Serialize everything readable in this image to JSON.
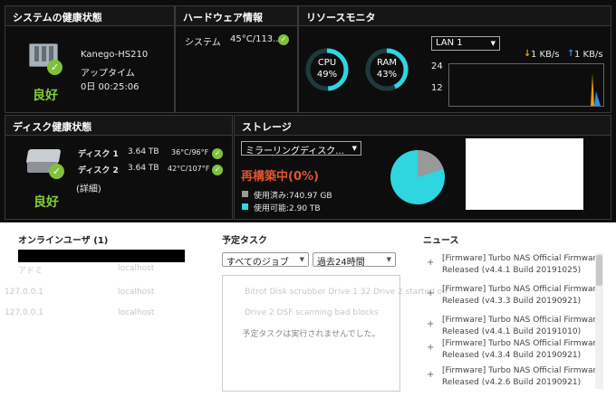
{
  "system_health": {
    "title": "システムの健康状態",
    "server_name": "Kanego-HS210",
    "uptime_label": "アップタイム",
    "uptime_value": "0日 00:25:06",
    "status": "良好"
  },
  "hardware_info": {
    "title": "ハードウェア情報",
    "system_label": "システム",
    "system_value": "45°C/113..."
  },
  "resource_monitor": {
    "title": "リソースモニタ",
    "cpu": {
      "label": "CPU",
      "value": "49%",
      "fraction": 0.49
    },
    "ram": {
      "label": "RAM",
      "value": "43%",
      "fraction": 0.43
    },
    "lan_select": "LAN 1",
    "download": "1 KB/s",
    "upload": "1 KB/s",
    "y_ticks": [
      "24",
      "12"
    ]
  },
  "disk_health": {
    "title": "ディスク健康状態",
    "disks": [
      {
        "label": "ディスク 1",
        "size": "3.64 TB",
        "temp": "36°C/96°F"
      },
      {
        "label": "ディスク 2",
        "size": "3.64 TB",
        "temp": "42°C/107°F"
      }
    ],
    "details_link": "(詳細)",
    "status": "良好"
  },
  "storage": {
    "title": "ストレージ",
    "volume_select": "ミラーリングディスク...",
    "rebuild_status": "再構築中(0%)",
    "used": "使用済み:740.97 GB",
    "available": "使用可能:2.90 TB",
    "used_fraction": 0.2
  },
  "online_users": {
    "title": "オンラインユーザ (1)",
    "ghost_rows": [
      [
        "アドミ",
        "localhost"
      ],
      [
        "127.0.0.1",
        "localhost"
      ],
      [
        "127.0.0.1",
        "localhost"
      ]
    ]
  },
  "scheduled_tasks": {
    "title": "予定タスク",
    "job_select": "すべてのジョブ",
    "period_select": "過去24時間",
    "empty_message": "予定タスクは実行されませんでした。",
    "ghost_lines": [
      "Bitrot Disk scrubber Drive 1 32 Drive 2 started on",
      "Drive 2 DSF scanning bad blocks"
    ]
  },
  "news": {
    "title": "ニュース",
    "items": [
      "[Firmware] Turbo NAS Official Firmware Released (v4.4.1 Build 20191025)",
      "[Firmware] Turbo NAS Official Firmware Released (v4.3.3 Build 20190921)",
      "[Firmware] Turbo NAS Official Firmware Released (v4.4.1 Build 20191010)",
      "[Firmware] Turbo NAS Official Firmware Released (v4.3.4 Build 20190921)",
      "[Firmware] Turbo NAS Official Firmware Released (v4.2.6 Build 20190921)"
    ]
  },
  "colors": {
    "accent_cyan": "#2ed6e0",
    "good_green": "#7fcf2e",
    "rebuild_red": "#e2532b"
  }
}
